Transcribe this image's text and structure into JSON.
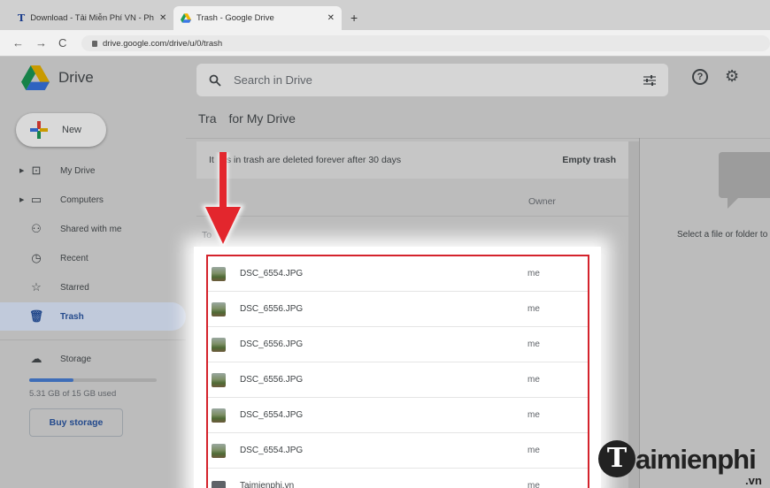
{
  "browser": {
    "tabs": [
      {
        "label": "Download - Tải Miễn Phí VN - Ph",
        "active": false,
        "close": "✕"
      },
      {
        "label": "Trash - Google Drive",
        "active": true,
        "close": "✕"
      }
    ],
    "new_tab": "+",
    "url": "drive.google.com/drive/u/0/trash"
  },
  "header": {
    "app_name": "Drive",
    "search_placeholder": "Search in Drive"
  },
  "sidebar": {
    "new_label": "New",
    "items": [
      {
        "label": "My Drive",
        "icon": "my-drive-icon",
        "expandable": true,
        "selected": false
      },
      {
        "label": "Computers",
        "icon": "computers-icon",
        "expandable": true,
        "selected": false
      },
      {
        "label": "Shared with me",
        "icon": "shared-icon",
        "expandable": false,
        "selected": false
      },
      {
        "label": "Recent",
        "icon": "clock-icon",
        "expandable": false,
        "selected": false
      },
      {
        "label": "Starred",
        "icon": "star-icon",
        "expandable": false,
        "selected": false
      },
      {
        "label": "Trash",
        "icon": "trash-icon",
        "expandable": false,
        "selected": true
      }
    ],
    "storage_label": "Storage",
    "storage_used_fraction": 0.35,
    "storage_text": "5.31 GB of 15 GB used",
    "buy_storage": "Buy storage"
  },
  "main": {
    "title_part1": "Tra",
    "title_part2": "for My Drive",
    "notice_part1": "It",
    "notice_part2": "s in trash are deleted forever after 30 days",
    "empty_trash": "Empty trash",
    "owner_header": "Owner",
    "section_label": "To",
    "files": [
      {
        "name": "DSC_6554.JPG",
        "owner": "me",
        "type": "image"
      },
      {
        "name": "DSC_6556.JPG",
        "owner": "me",
        "type": "image"
      },
      {
        "name": "DSC_6556.JPG",
        "owner": "me",
        "type": "image"
      },
      {
        "name": "DSC_6556.JPG",
        "owner": "me",
        "type": "image"
      },
      {
        "name": "DSC_6554.JPG",
        "owner": "me",
        "type": "image"
      },
      {
        "name": "DSC_6554.JPG",
        "owner": "me",
        "type": "image"
      },
      {
        "name": "Taimienphi.vn",
        "owner": "me",
        "type": "folder"
      }
    ]
  },
  "details": {
    "empty_text": "Select a file or folder to"
  },
  "watermark": {
    "letter": "T",
    "text": "aimienphi",
    "suffix": ".vn"
  },
  "colors": {
    "highlight_border": "#d4232c",
    "arrow": "#e3262d",
    "selected_nav": "#c1cadb",
    "link_blue": "#244a8c"
  }
}
